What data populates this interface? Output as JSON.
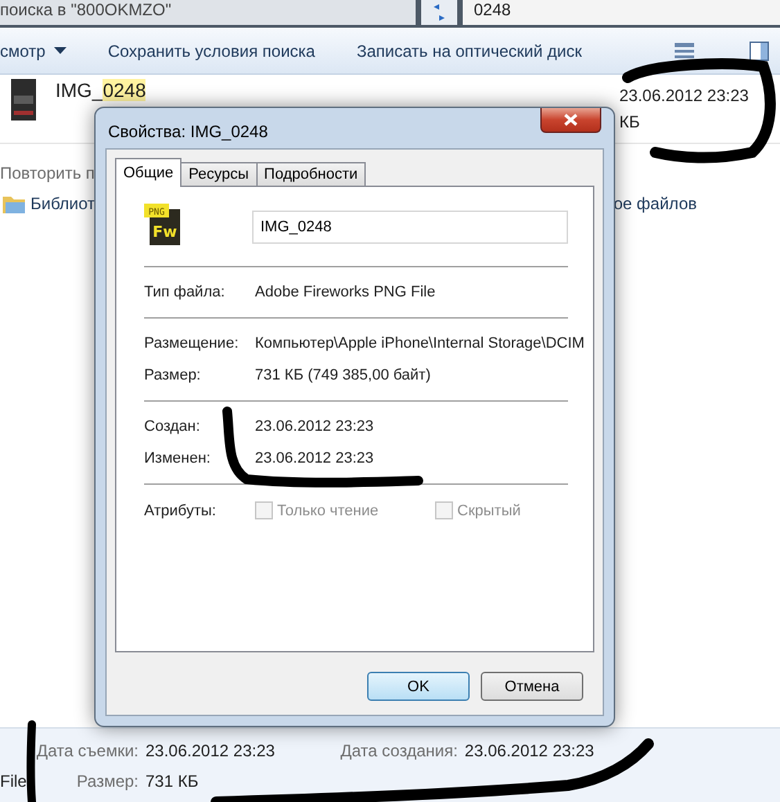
{
  "explorer": {
    "address": "поиска в \"800OKMZO\"",
    "search_value": "0248",
    "toolbar": [
      {
        "label": "смотр",
        "dropdown": true
      },
      {
        "label": "Сохранить условия поиска",
        "dropdown": false
      },
      {
        "label": "Записать на оптический диск",
        "dropdown": false
      }
    ],
    "result": {
      "name_plain": "IMG_",
      "name_match": "0248",
      "date": "23.06.2012 23:23",
      "size": "КБ"
    },
    "repeat_search": "Повторить п",
    "library": "Библиот",
    "library_right": "ое файлов",
    "details": [
      {
        "label": "Дата съемки:",
        "value": "23.06.2012 23:23"
      },
      {
        "label": "Дата создания:",
        "value": "23.06.2012 23:23"
      }
    ],
    "details_type": "File",
    "details_size": {
      "label": "Размер:",
      "value": "731 КБ"
    }
  },
  "dialog": {
    "title": "Свойства: IMG_0248",
    "tabs": [
      {
        "label": "Общие",
        "selected": true
      },
      {
        "label": "Ресурсы",
        "selected": false
      },
      {
        "label": "Подробности",
        "selected": false
      }
    ],
    "icon_badge": "PNG",
    "icon_letters": "Fw",
    "file_name": "IMG_0248",
    "groups": [
      [
        {
          "label": "Тип файла:",
          "value": "Adobe Fireworks PNG File"
        }
      ],
      [
        {
          "label": "Размещение:",
          "value": "Компьютер\\Apple iPhone\\Internal Storage\\DCIM"
        },
        {
          "label": "Размер:",
          "value": "731 КБ (749 385,00 байт)"
        }
      ],
      [
        {
          "label": "Создан:",
          "value": "23.06.2012 23:23"
        },
        {
          "label": "Изменен:",
          "value": "23.06.2012 23:23"
        }
      ]
    ],
    "attributes_label": "Атрибуты:",
    "attributes": [
      {
        "label": "Только чтение",
        "checked": false,
        "disabled": true
      },
      {
        "label": "Скрытый",
        "checked": false,
        "disabled": true
      }
    ],
    "buttons": [
      {
        "label": "OK",
        "default": true
      },
      {
        "label": "Отмена",
        "default": false
      }
    ]
  }
}
